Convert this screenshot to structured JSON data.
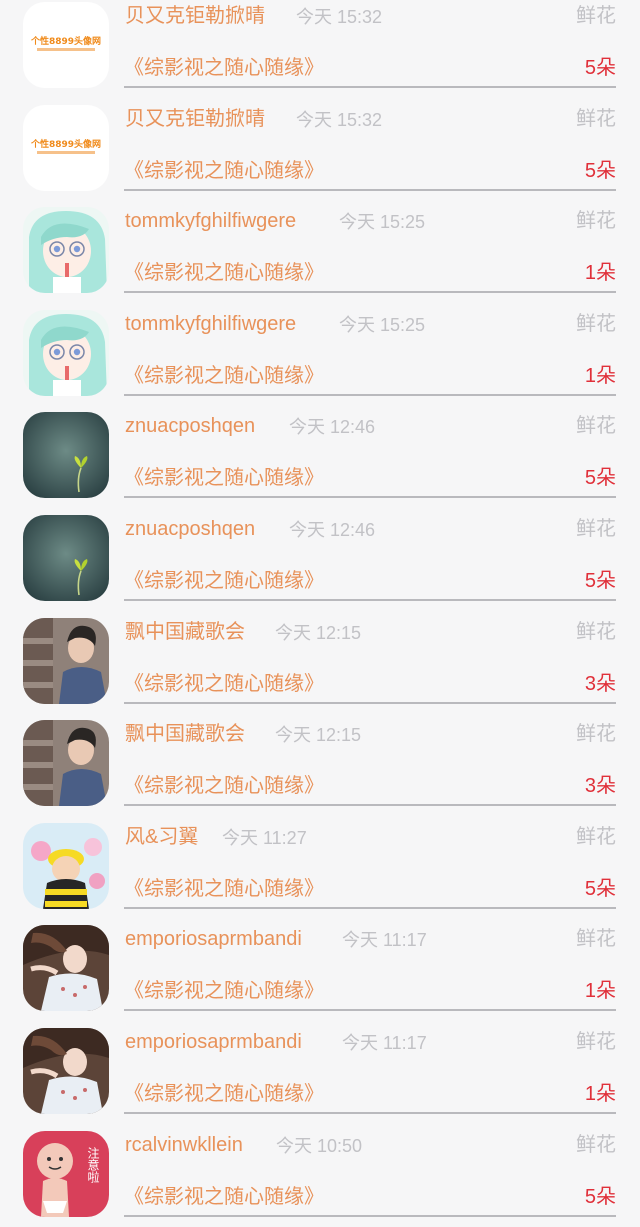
{
  "records": [
    {
      "user": "贝又克钜勒掀晴",
      "time": "今天 15:32",
      "gift": "鲜花",
      "work": "《综影视之随心随缘》",
      "count": "5朵",
      "avatar": "logo-avatar",
      "avatar_text": "个性8899头像网"
    },
    {
      "user": "贝又克钜勒掀晴",
      "time": "今天 15:32",
      "gift": "鲜花",
      "work": "《综影视之随心随缘》",
      "count": "5朵",
      "avatar": "logo-avatar",
      "avatar_text": "个性8899头像网"
    },
    {
      "user": "tommkyfghilfiwgere",
      "time": "今天 15:25",
      "gift": "鲜花",
      "work": "《综影视之随心随缘》",
      "count": "1朵",
      "avatar": "anime-girl-avatar"
    },
    {
      "user": "tommkyfghilfiwgere",
      "time": "今天 15:25",
      "gift": "鲜花",
      "work": "《综影视之随心随缘》",
      "count": "1朵",
      "avatar": "anime-girl-avatar"
    },
    {
      "user": "znuacposhqen",
      "time": "今天 12:46",
      "gift": "鲜花",
      "work": "《综影视之随心随缘》",
      "count": "5朵",
      "avatar": "sprout-avatar"
    },
    {
      "user": "znuacposhqen",
      "time": "今天 12:46",
      "gift": "鲜花",
      "work": "《综影视之随心随缘》",
      "count": "5朵",
      "avatar": "sprout-avatar"
    },
    {
      "user": "飘中国藏歌会",
      "time": "今天 12:15",
      "gift": "鲜花",
      "work": "《综影视之随心随缘》",
      "count": "3朵",
      "avatar": "man-portrait-avatar"
    },
    {
      "user": "飘中国藏歌会",
      "time": "今天 12:15",
      "gift": "鲜花",
      "work": "《综影视之随心随缘》",
      "count": "3朵",
      "avatar": "man-portrait-avatar"
    },
    {
      "user": "风&习翼",
      "time": "今天 11:27",
      "gift": "鲜花",
      "work": "《综影视之随心随缘》",
      "count": "5朵",
      "avatar": "baby-bee-avatar"
    },
    {
      "user": "emporiosaprmbandi",
      "time": "今天 11:17",
      "gift": "鲜花",
      "work": "《综影视之随心随缘》",
      "count": "1朵",
      "avatar": "woman-lying-avatar"
    },
    {
      "user": "emporiosaprmbandi",
      "time": "今天 11:17",
      "gift": "鲜花",
      "work": "《综影视之随心随缘》",
      "count": "1朵",
      "avatar": "woman-lying-avatar"
    },
    {
      "user": "rcalvinwkllein",
      "time": "今天 10:50",
      "gift": "鲜花",
      "work": "《综影视之随心随缘》",
      "count": "5朵",
      "avatar": "cartoon-baby-avatar",
      "avatar_text": "注意啦"
    }
  ],
  "colors": {
    "name": "#e8925a",
    "meta": "#c2c2c6",
    "count": "#e0303a",
    "separator": "#b9b9bd",
    "background": "#f6f6f7"
  }
}
